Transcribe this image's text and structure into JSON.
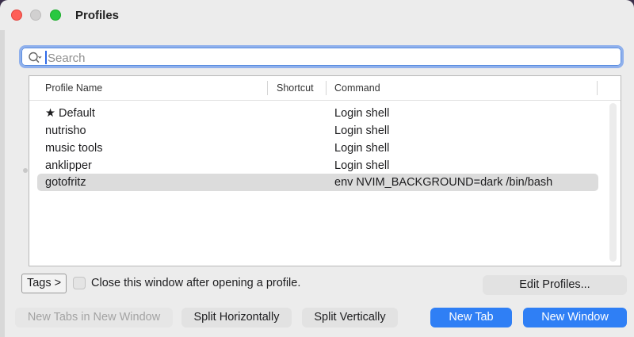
{
  "window": {
    "title": "Profiles"
  },
  "search": {
    "placeholder": "Search",
    "value": ""
  },
  "table": {
    "headers": {
      "name": "Profile Name",
      "shortcut": "Shortcut",
      "command": "Command"
    },
    "rows": [
      {
        "name": "Default",
        "is_default": true,
        "shortcut": "",
        "command": "Login shell",
        "selected": false
      },
      {
        "name": "nutrisho",
        "is_default": false,
        "shortcut": "",
        "command": "Login shell",
        "selected": false
      },
      {
        "name": "music tools",
        "is_default": false,
        "shortcut": "",
        "command": "Login shell",
        "selected": false
      },
      {
        "name": "anklipper",
        "is_default": false,
        "shortcut": "",
        "command": "Login shell",
        "selected": false
      },
      {
        "name": "gotofritz",
        "is_default": false,
        "shortcut": "",
        "command": "env NVIM_BACKGROUND=dark /bin/bash",
        "selected": true
      }
    ]
  },
  "options": {
    "tags_label": "Tags >",
    "close_after_open_label": "Close this window after opening a profile.",
    "close_after_open_checked": false
  },
  "buttons": {
    "edit_profiles": "Edit Profiles...",
    "new_tabs_in_new_window": "New Tabs in New Window",
    "split_horizontally": "Split Horizontally",
    "split_vertically": "Split Vertically",
    "new_tab": "New Tab",
    "new_window": "New Window"
  },
  "icons": {
    "search": "search-icon",
    "default_marker": "star-icon"
  },
  "colors": {
    "accent": "#2f7ff5",
    "focus_ring": "#8fb0ec",
    "selected_row": "#dcdcdc"
  }
}
